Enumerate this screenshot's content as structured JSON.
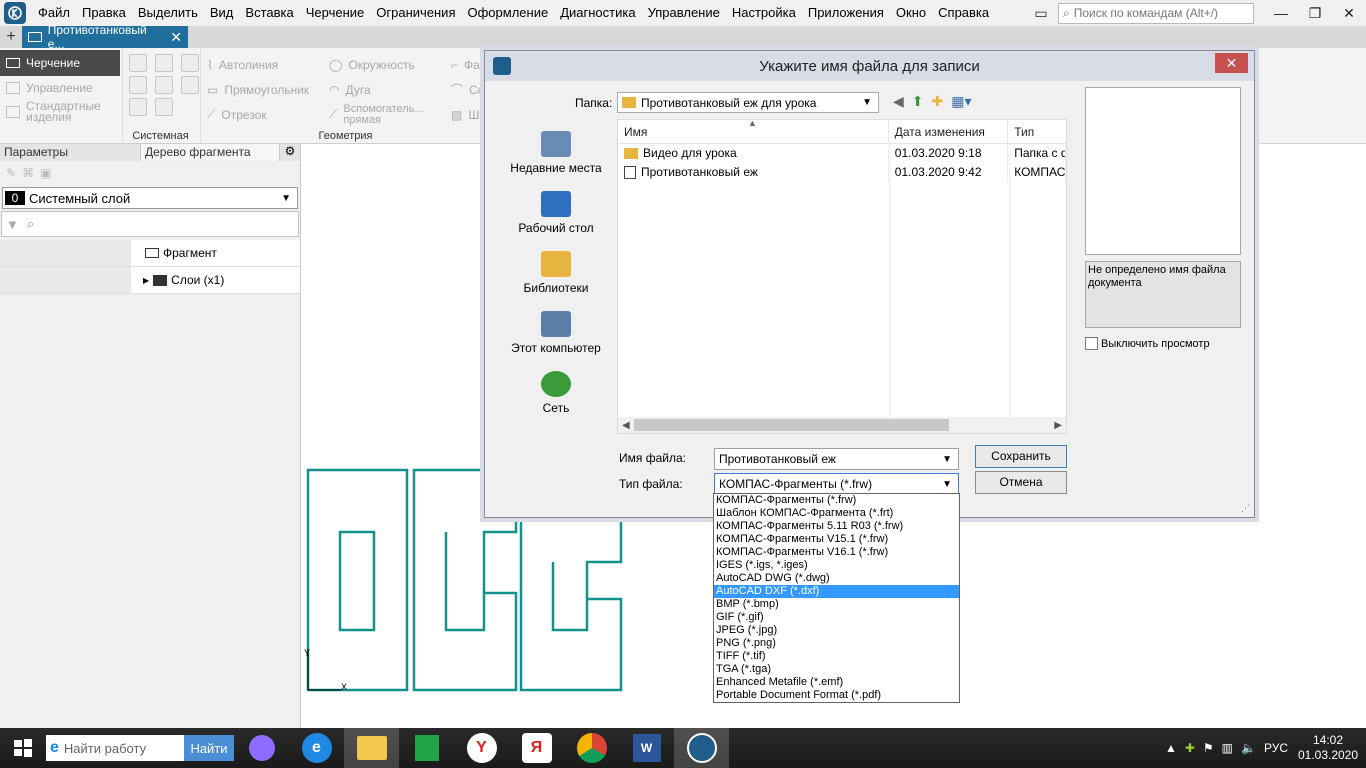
{
  "menu": [
    "Файл",
    "Правка",
    "Выделить",
    "Вид",
    "Вставка",
    "Черчение",
    "Ограничения",
    "Оформление",
    "Диагностика",
    "Управление",
    "Настройка",
    "Приложения",
    "Окно",
    "Справка"
  ],
  "search_placeholder": "Поиск по командам (Alt+/)",
  "doc_tab": "Противотанковый е...",
  "ribbon": {
    "mode": "Черчение",
    "manage": "Управление",
    "standard_parts": "Стандартные изделия",
    "group_system": "Системная",
    "group_geometry": "Геометрия",
    "autoline": "Автолиния",
    "rectangle": "Прямоугольник",
    "segment": "Отрезок",
    "circle": "Окружность",
    "arc": "Дуга",
    "aux_line": "Вспомогатель... прямая",
    "fa": "Фа",
    "skr": "Скр",
    "sht": "Шт"
  },
  "panel": {
    "tab_params": "Параметры",
    "tab_tree": "Дерево фрагмента",
    "layer_num": "0",
    "layer_name": "Системный слой",
    "tree_fragment": "Фрагмент",
    "tree_layers": "Слои (x1)"
  },
  "canvas": {
    "axis_y": "Y",
    "axis_x": "X",
    "color": "#13918c"
  },
  "dialog": {
    "title": "Укажите имя файла для записи",
    "folder_label": "Папка:",
    "folder_value": "Противотанковый еж для урока",
    "places": [
      "Недавние места",
      "Рабочий стол",
      "Библиотеки",
      "Этот компьютер",
      "Сеть"
    ],
    "columns": [
      "Имя",
      "Дата изменения",
      "Тип"
    ],
    "files": [
      {
        "name": "Видео для урока",
        "date": "01.03.2020 9:18",
        "type": "Папка с ф",
        "icon": "folder-icon"
      },
      {
        "name": "Противотанковый еж",
        "date": "01.03.2020 9:42",
        "type": "КОМПАС",
        "icon": "kompas-file-icon"
      }
    ],
    "preview_msg": "Не определено имя файла документа",
    "disable_preview": "Выключить просмотр",
    "filename_label": "Имя файла:",
    "filename_value": "Противотанковый еж",
    "filetype_label": "Тип файла:",
    "filetype_value": "КОМПАС-Фрагменты (*.frw)",
    "save": "Сохранить",
    "cancel": "Отмена"
  },
  "filetypes": [
    "КОМПАС-Фрагменты (*.frw)",
    "Шаблон КОМПАС-Фрагмента (*.frt)",
    "КОМПАС-Фрагменты 5.11 R03 (*.frw)",
    "КОМПАС-Фрагменты V15.1 (*.frw)",
    "КОМПАС-Фрагменты V16.1 (*.frw)",
    "IGES (*.igs, *.iges)",
    "AutoCAD DWG (*.dwg)",
    "AutoCAD DXF (*.dxf)",
    "BMP (*.bmp)",
    "GIF (*.gif)",
    "JPEG (*.jpg)",
    "PNG (*.png)",
    "TIFF (*.tif)",
    "TGA (*.tga)",
    "Enhanced Metafile (*.emf)",
    "Portable Document Format (*.pdf)"
  ],
  "filetype_selected": "AutoCAD DXF (*.dxf)",
  "taskbar": {
    "search_placeholder": "Найти работу",
    "search_button": "Найти",
    "lang": "РУС",
    "time": "14:02",
    "date": "01.03.2020"
  }
}
